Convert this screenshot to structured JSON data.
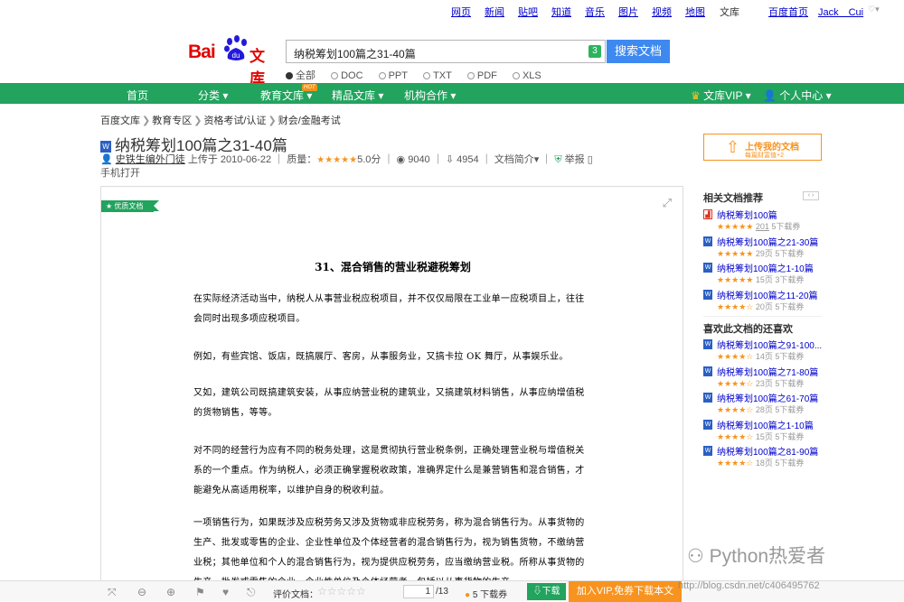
{
  "topnav": {
    "items": [
      "网页",
      "新闻",
      "贴吧",
      "知道",
      "音乐",
      "图片",
      "视频",
      "地图",
      "文库"
    ],
    "home": "百度首页",
    "user": "Jack　Cui"
  },
  "logo": {
    "bai": "Bai",
    "du": "du",
    "wenku": "文库"
  },
  "search": {
    "value": "纳税筹划100篇之31-40篇",
    "count": "3",
    "button": "搜索文档"
  },
  "filetypes": [
    "全部",
    "DOC",
    "PPT",
    "TXT",
    "PDF",
    "XLS"
  ],
  "greenbar": {
    "items": [
      "首页",
      "分类 ▾",
      "教育文库 ▾",
      "精品文库 ▾",
      "机构合作 ▾"
    ],
    "hot": "HOT",
    "vip": "文库VIP ▾",
    "user": "个人中心 ▾"
  },
  "breadcrumb": [
    "百度文库",
    "教育专区",
    "资格考试/认证",
    "财会/金融考试"
  ],
  "doc": {
    "icon": "W",
    "title": "纳税筹划100篇之31-40篇",
    "uploader": "史铁生编外门徒",
    "uploaded": "上传于 2010-06-22",
    "quality_label": "质量：",
    "stars": "★★★★★",
    "score": "5.0分",
    "views": "9040",
    "downloads": "4954",
    "intro": "文档简介",
    "report": "举报",
    "mobile": "手机打开"
  },
  "upload": {
    "title": "上传我的文档",
    "sub": "每篇财富值+2"
  },
  "related": {
    "title": "相关文档推荐",
    "items": [
      {
        "name": "纳税筹划100篇",
        "stars": "★★★★★",
        "pages": "201",
        "dl": "5下载券",
        "type": "pdf"
      },
      {
        "name": "纳税筹划100篇之21-30篇",
        "stars": "★★★★★",
        "pages": "29页",
        "dl": "5下载券",
        "type": "doc"
      },
      {
        "name": "纳税筹划100篇之1-10篇",
        "stars": "★★★★★",
        "pages": "15页",
        "dl": "3下载券",
        "type": "doc"
      },
      {
        "name": "纳税筹划100篇之11-20篇",
        "stars": "★★★★☆",
        "pages": "20页",
        "dl": "5下载券",
        "type": "doc"
      }
    ]
  },
  "liked": {
    "title": "喜欢此文档的还喜欢",
    "items": [
      {
        "name": "纳税筹划100篇之91-100...",
        "stars": "★★★★☆",
        "pages": "14页",
        "dl": "5下载券"
      },
      {
        "name": "纳税筹划100篇之71-80篇",
        "stars": "★★★★☆",
        "pages": "23页",
        "dl": "5下载券"
      },
      {
        "name": "纳税筹划100篇之61-70篇",
        "stars": "★★★★☆",
        "pages": "28页",
        "dl": "5下载券"
      },
      {
        "name": "纳税筹划100篇之1-10篇",
        "stars": "★★★★☆",
        "pages": "15页",
        "dl": "5下载券"
      },
      {
        "name": "纳税筹划100篇之81-90篇",
        "stars": "★★★★☆",
        "pages": "18页",
        "dl": "5下载券"
      }
    ]
  },
  "content": {
    "ribbon": "优质文档",
    "heading": "31、混合销售的营业税避税筹划",
    "paragraphs": [
      "在实际经济活动当中，纳税人从事营业税应税项目，并不仅仅局限在工业单一应税项目上，往往会同时出现多项应税项目。",
      "例如，有些宾馆、饭店，既搞展厅、客房，从事服务业，又搞卡拉 OK 舞厅，从事娱乐业。",
      "又如，建筑公司既搞建筑安装，从事应纳营业税的建筑业，又搞建筑材料销售，从事应纳增值税的货物销售，等等。",
      "对不同的经营行为应有不同的税务处理，这是贯彻执行营业税条例，正确处理营业税与增值税关系的一个重点。作为纳税人，必须正确掌握税收政策，准确界定什么是兼营销售和混合销售，才能避免从高适用税率，以维护自身的税收利益。",
      "一项销售行为，如果既涉及应税劳务又涉及货物或非应税劳务，称为混合销售行为。从事货物的生产、批发或零售的企业、企业性单位及个体经营者的混合销售行为，视为销售货物，不缴纳营业税；其他单位和个人的混合销售行为，视为提供应税劳务，应当缴纳营业税。所称从事货物的生产、批发或零售的企业，企业性单位及个体经营者，包括以从事货物的生产"
    ]
  },
  "bottombar": {
    "rate": "评价文档：",
    "stars": "☆☆☆☆☆",
    "page": "1",
    "total": "/13",
    "cost": "5 下载券",
    "download": "下载",
    "vip": "加入VIP,免券下载本文"
  },
  "watermark": {
    "text": "Python热爱者",
    "url": "http://blog.csdn.net/c406495762"
  }
}
